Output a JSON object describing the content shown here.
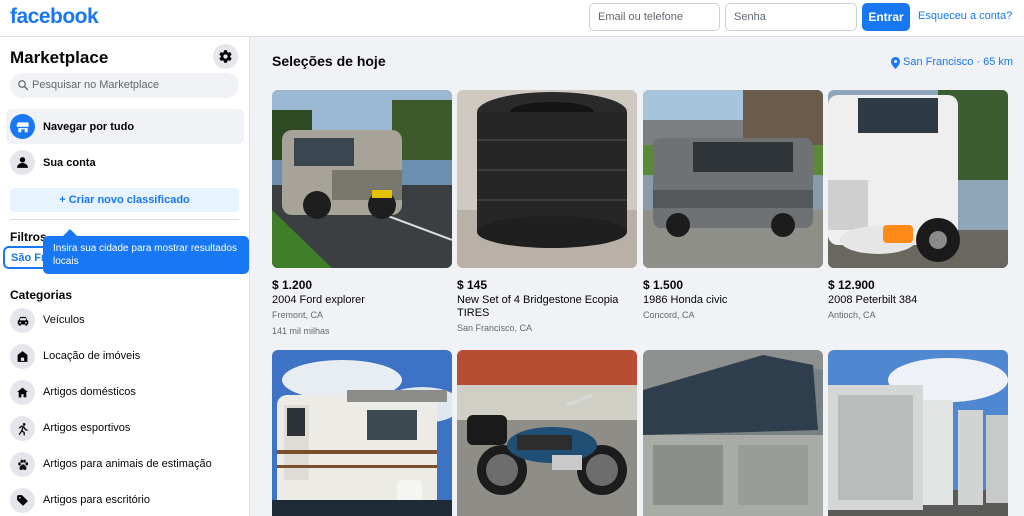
{
  "header": {
    "logo": "facebook",
    "email_placeholder": "Email ou telefone",
    "password_placeholder": "Senha",
    "login_label": "Entrar",
    "forgot_label": "Esqueceu a conta?"
  },
  "sidebar": {
    "title": "Marketplace",
    "search_placeholder": "Pesquisar no Marketplace",
    "nav": [
      {
        "label": "Navegar por tudo",
        "icon": "storefront-icon"
      },
      {
        "label": "Sua conta",
        "icon": "person-icon"
      }
    ],
    "create_label": "+ Criar novo classificado",
    "filters_title": "Filtros",
    "location_value": "São Francisco",
    "tooltip": "Insira sua cidade para mostrar resultados locais",
    "categories_title": "Categorias",
    "categories": [
      {
        "label": "Veículos",
        "icon": "car-icon"
      },
      {
        "label": "Locação de imóveis",
        "icon": "house-icon"
      },
      {
        "label": "Artigos domésticos",
        "icon": "home-icon"
      },
      {
        "label": "Artigos esportivos",
        "icon": "running-icon"
      },
      {
        "label": "Artigos para animais de estimação",
        "icon": "paw-icon"
      },
      {
        "label": "Artigos para escritório",
        "icon": "tag-icon"
      }
    ]
  },
  "main": {
    "title": "Seleções de hoje",
    "location_label": "San Francisco · 65 km",
    "listings": [
      {
        "price": "$ 1.200",
        "title": "2004 Ford explorer",
        "location": "Fremont, CA",
        "mileage": "141 mil milhas"
      },
      {
        "price": "$ 145",
        "title": "New Set of 4 Bridgestone Ecopia TIRES",
        "location": "San Francisco, CA"
      },
      {
        "price": "$ 1.500",
        "title": "1986 Honda civic",
        "location": "Concord, CA"
      },
      {
        "price": "$ 12.900",
        "title": "2008 Peterbilt 384",
        "location": "Antioch, CA"
      },
      {
        "price": "",
        "title": "",
        "location": ""
      },
      {
        "price": "",
        "title": "",
        "location": ""
      },
      {
        "price": "",
        "title": "",
        "location": ""
      },
      {
        "price": "",
        "title": "",
        "location": ""
      }
    ]
  },
  "colors": {
    "brand": "#1877f2",
    "background": "#f0f2f5",
    "secondary_text": "#65676b"
  }
}
